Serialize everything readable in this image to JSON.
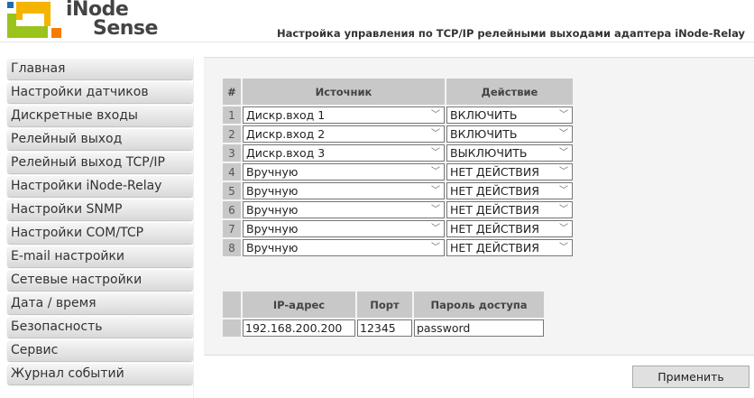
{
  "header": {
    "brand_line1": "iNode",
    "brand_line2": "Sense",
    "title": "Настройка управления по TCP/IP релейными выходами адаптера iNode-Relay"
  },
  "sidebar": {
    "items": [
      {
        "label": "Главная"
      },
      {
        "label": "Настройки датчиков"
      },
      {
        "label": "Дискретные входы"
      },
      {
        "label": "Релейный выход"
      },
      {
        "label": "Релейный выход TCP/IP"
      },
      {
        "label": "Настройки iNode-Relay"
      },
      {
        "label": "Настройки SNMP"
      },
      {
        "label": "Настройки COM/TCP"
      },
      {
        "label": "E-mail настройки"
      },
      {
        "label": "Сетевые настройки"
      },
      {
        "label": "Дата / время"
      },
      {
        "label": "Безопасность"
      },
      {
        "label": "Сервис"
      },
      {
        "label": "Журнал событий"
      }
    ]
  },
  "rules": {
    "headers": {
      "num": "#",
      "source": "Источник",
      "action": "Действие"
    },
    "rows": [
      {
        "num": "1",
        "source": "Дискр.вход 1",
        "action": "ВКЛЮЧИТЬ"
      },
      {
        "num": "2",
        "source": "Дискр.вход 2",
        "action": "ВКЛЮЧИТЬ"
      },
      {
        "num": "3",
        "source": "Дискр.вход 3",
        "action": "ВЫКЛЮЧИТЬ"
      },
      {
        "num": "4",
        "source": "Вручную",
        "action": "НЕТ ДЕЙСТВИЯ"
      },
      {
        "num": "5",
        "source": "Вручную",
        "action": "НЕТ ДЕЙСТВИЯ"
      },
      {
        "num": "6",
        "source": "Вручную",
        "action": "НЕТ ДЕЙСТВИЯ"
      },
      {
        "num": "7",
        "source": "Вручную",
        "action": "НЕТ ДЕЙСТВИЯ"
      },
      {
        "num": "8",
        "source": "Вручную",
        "action": "НЕТ ДЕЙСТВИЯ"
      }
    ]
  },
  "connection": {
    "headers": {
      "ip": "IP-адрес",
      "port": "Порт",
      "password": "Пароль доступа"
    },
    "ip": "192.168.200.200",
    "port": "12345",
    "password": "password"
  },
  "apply_label": "Применить",
  "chevron": "﹀"
}
